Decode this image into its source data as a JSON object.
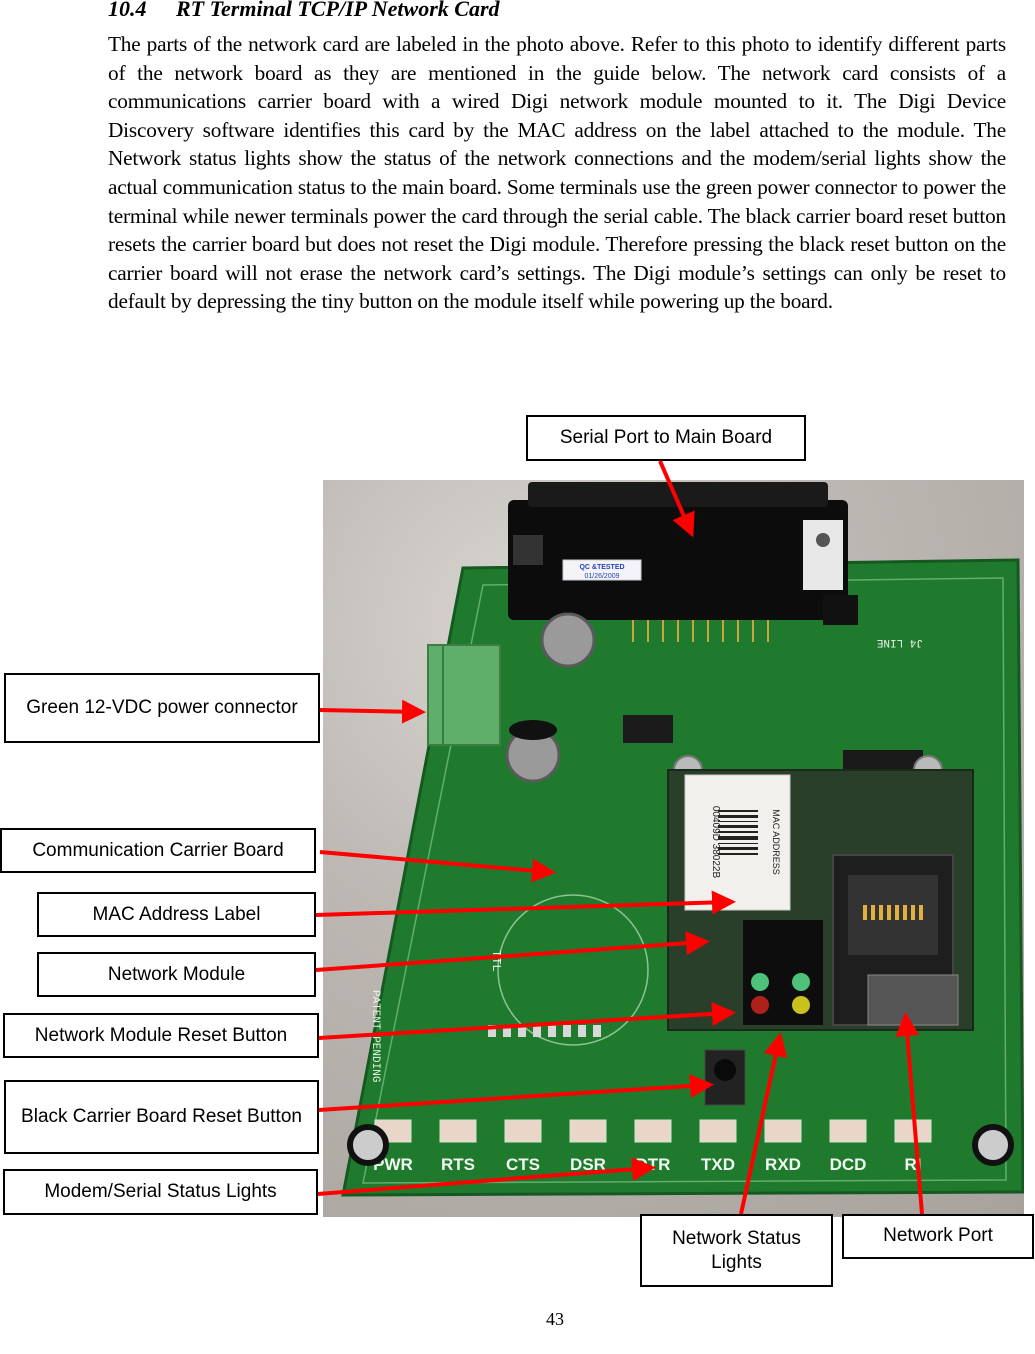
{
  "section": {
    "number": "10.4",
    "title": "RT Terminal TCP/IP Network Card"
  },
  "body_text": "The parts of the network card are labeled in the photo above. Refer to this photo to identify different parts of the network board as they are mentioned in the guide below. The network card consists of a communications carrier board with a wired Digi network module mounted to it. The Digi Device Discovery software identifies this card by the MAC address on the label attached to the module. The Network status lights show the status of the network connections and the modem/serial lights show the actual communication status to the main board. Some terminals use the green power connector to power the terminal while newer terminals power the card through the serial cable. The black carrier board reset button resets the carrier board but does not reset the Digi module. Therefore pressing the black reset button on the carrier board will not erase the network card’s settings. The Digi module’s settings can only be reset to default by depressing the tiny button on the module itself while powering up the board.",
  "callouts": {
    "serial_port": "Serial Port to Main Board",
    "power_connector": "Green 12-VDC power connector",
    "carrier_board": "Communication Carrier Board",
    "mac_label": "MAC Address Label",
    "network_module": "Network Module",
    "module_reset": "Network Module Reset Button",
    "carrier_reset": "Black Carrier Board Reset Button",
    "modem_lights": "Modem/Serial Status Lights",
    "network_lights": "Network Status Lights",
    "network_port": "Network Port"
  },
  "photo": {
    "qc_sticker_line1": "QC &TESTED",
    "qc_sticker_line2": "01/26/2009",
    "mac_sticker_title": "MAC ADDRESS",
    "mac_sticker_value": "00409D 38022B",
    "led_labels": [
      "PWR",
      "RTS",
      "CTS",
      "DSR",
      "DTR",
      "TXD",
      "RXD",
      "DCD",
      "RI"
    ],
    "board_text": "PATENT PENDING",
    "ttl_label": "TTL",
    "line_label": "J4 LINE",
    "arrow_color": "#ff0000",
    "board_color": "#1f7a2e"
  },
  "page_number": "43"
}
